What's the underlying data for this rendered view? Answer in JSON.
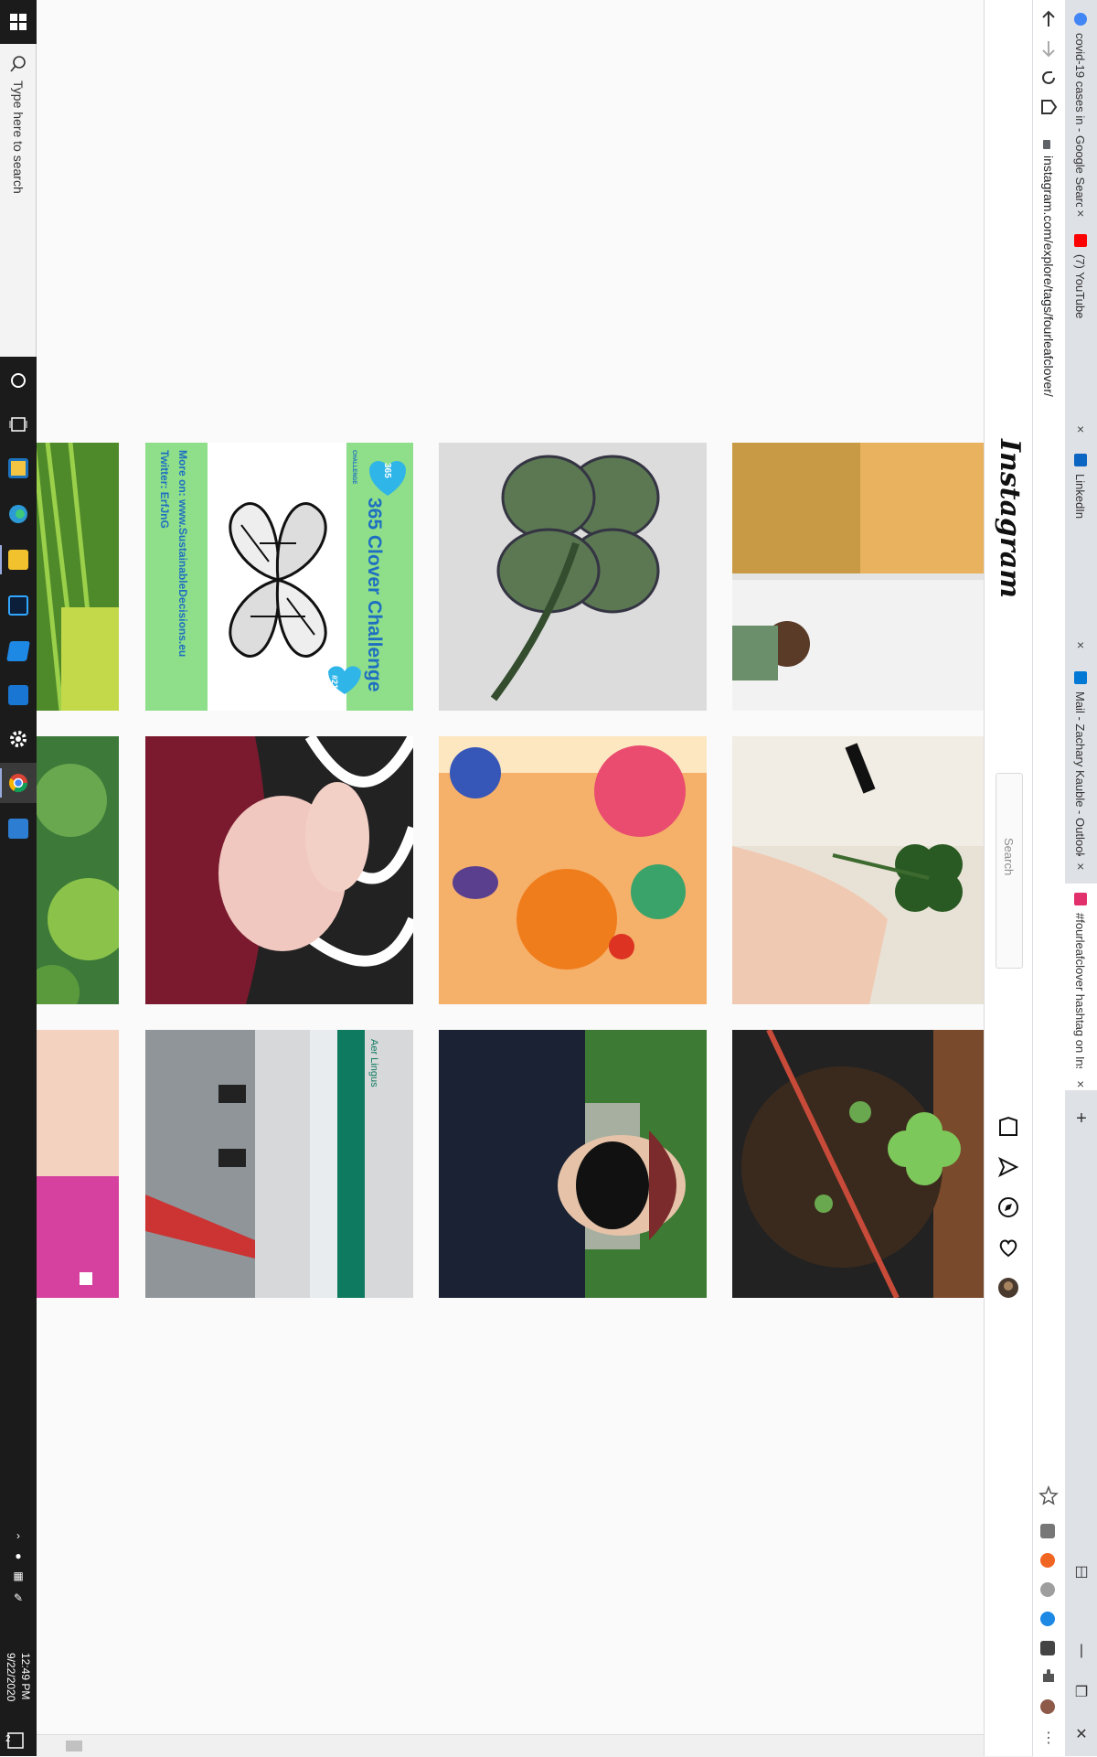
{
  "taskbar": {
    "search_placeholder": "Type here to search",
    "clock_time": "12:49 PM",
    "clock_date": "9/22/2020",
    "notification_count": "2",
    "apps": [
      "cortana",
      "task-view",
      "file-explorer",
      "edge",
      "file-manager",
      "photoshop",
      "dev-app",
      "network-app",
      "settings",
      "chrome",
      "remote-desktop"
    ]
  },
  "browser": {
    "url": "instagram.com/explore/tags/fourleafclover/",
    "tabs": [
      {
        "title": "covid-19 cases in - Google Search",
        "favicon_color": "#4285f4",
        "active": false
      },
      {
        "title": "(7) YouTube",
        "favicon_color": "#ff0000",
        "active": false
      },
      {
        "title": "LinkedIn",
        "favicon_color": "#0a66c2",
        "active": false
      },
      {
        "title": "Mail - Zachary Kauble - Outlook",
        "favicon_color": "#0078d4",
        "active": false
      },
      {
        "title": "#fourleafclover hashtag on Insta",
        "favicon_color": "#e1306c",
        "active": true
      }
    ]
  },
  "instagram": {
    "logo": "Instagram",
    "search_placeholder": "Search",
    "nav": [
      "home-icon",
      "direct-icon",
      "explore-icon",
      "activity-icon",
      "profile-avatar"
    ]
  },
  "posts": {
    "clover_challenge_title": "365 Clover Challenge",
    "clover_challenge_badge_top": "365",
    "clover_challenge_badge_caption": "CHALLENGE",
    "clover_challenge_number": "#21",
    "clover_challenge_more": "More on: www.SustainableDecisions.eu",
    "clover_challenge_twitter": "Twitter: ErfJnG",
    "airline_text": "Aer Lingus"
  }
}
